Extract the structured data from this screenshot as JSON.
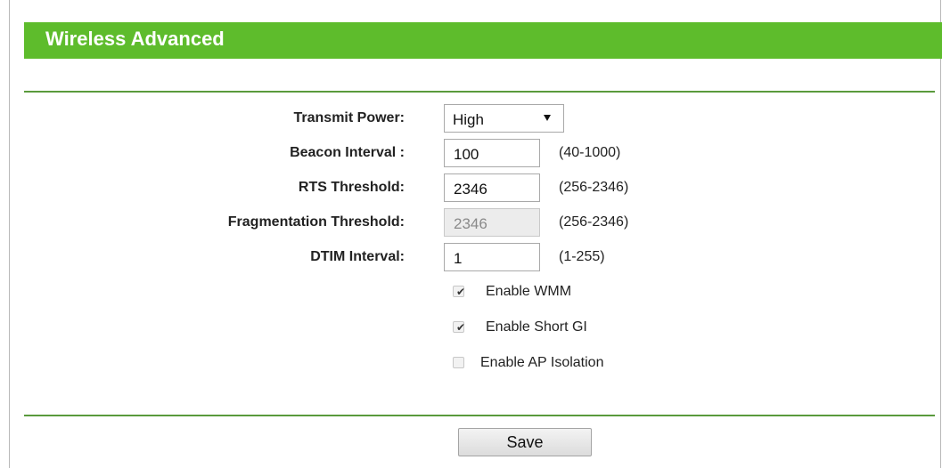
{
  "header": {
    "title": "Wireless Advanced"
  },
  "form": {
    "transmit_power": {
      "label": "Transmit Power:",
      "value": "High"
    },
    "beacon_interval": {
      "label": "Beacon Interval :",
      "value": "100",
      "range": "(40-1000)"
    },
    "rts_threshold": {
      "label": "RTS Threshold:",
      "value": "2346",
      "range": "(256-2346)"
    },
    "fragmentation_threshold": {
      "label": "Fragmentation Threshold:",
      "value": "2346",
      "range": "(256-2346)",
      "disabled": true
    },
    "dtim_interval": {
      "label": "DTIM Interval:",
      "value": "1",
      "range": "(1-255)"
    },
    "checkboxes": [
      {
        "label": "Enable WMM",
        "checked": true
      },
      {
        "label": "Enable Short GI",
        "checked": true
      },
      {
        "label": "Enable AP Isolation",
        "checked": false
      }
    ]
  },
  "actions": {
    "save_label": "Save"
  },
  "colors": {
    "accent": "#5ebc2c",
    "divider": "#5a9a3c"
  }
}
